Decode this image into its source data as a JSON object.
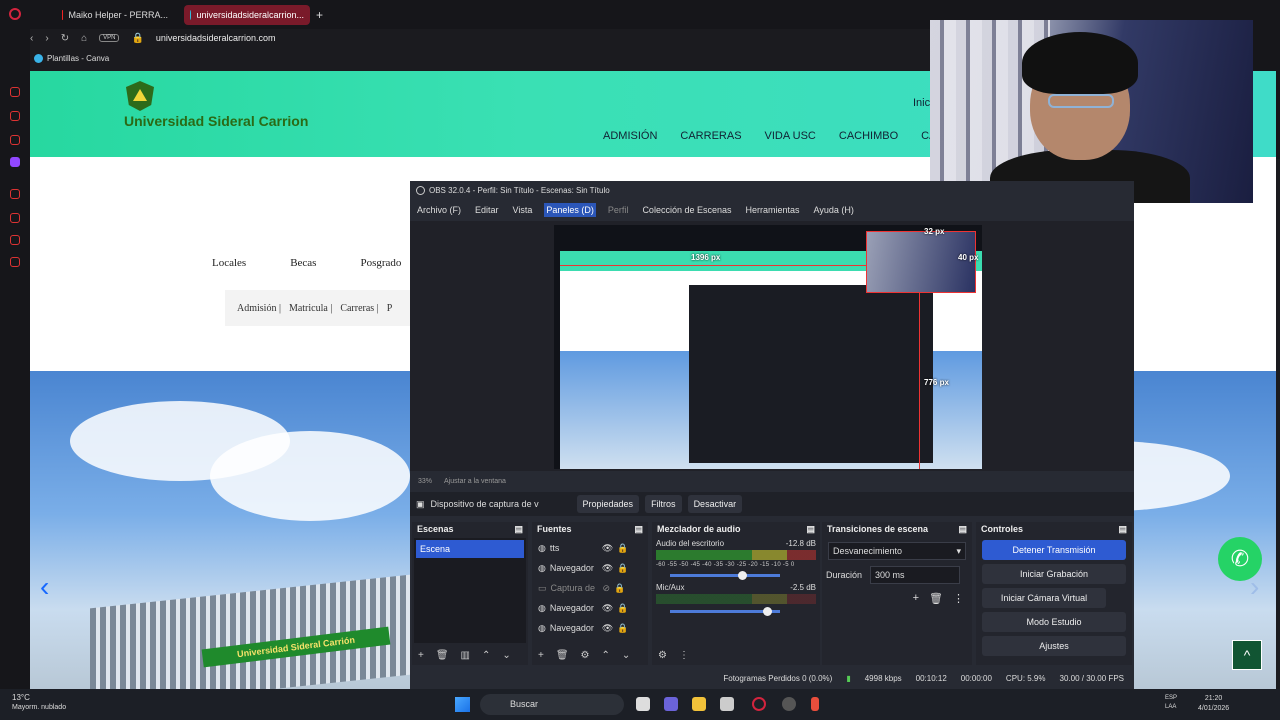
{
  "browser": {
    "tabs": [
      {
        "label": "Maiko Helper - PERRA...",
        "active": false
      },
      {
        "label": "universidadsideralcarrion...",
        "active": true
      }
    ],
    "vpn_label": "VPN",
    "url": "universidadsideralcarrion.com",
    "bookmark": "Plantillas - Canva"
  },
  "site": {
    "title": "Universidad Sideral Carrion",
    "top_link": "Inic",
    "menu": [
      "ADMISIÓN",
      "CARRERAS",
      "VIDA USC",
      "CACHIMBO",
      "CAMP"
    ],
    "subnav": [
      "Locales",
      "Becas",
      "Posgrado"
    ],
    "subbar": [
      "Admisión |",
      "Matricula |",
      "Carreras |",
      "P"
    ],
    "banner": "Universidad Sideral Carrión",
    "arrow_left": "‹",
    "arrow_right": "›",
    "whatsapp_icon": "✆",
    "up_icon": "^"
  },
  "obs": {
    "window_title": "OBS 32.0.4 - Perfil: Sin Título - Escenas: Sin Título",
    "menu": [
      "Archivo (F)",
      "Editar",
      "Vista",
      "Paneles (D)",
      "Perfil",
      "Colección de Escenas",
      "Herramientas",
      "Ayuda (H)"
    ],
    "measures": {
      "w": "1396 px",
      "top": "32 px",
      "right": "40 px",
      "bottom": "776 px"
    },
    "preview_status": {
      "zoom": "33%",
      "fit": "Ajustar a la ventana"
    },
    "source_bar": {
      "source": "Dispositivo de captura de v",
      "props": "Propiedades",
      "filters": "Filtros",
      "deactivate": "Desactivar"
    },
    "scenes": {
      "title": "Escenas",
      "items": [
        "Escena"
      ]
    },
    "sources": {
      "title": "Fuentes",
      "items": [
        {
          "name": "tts",
          "dim": false
        },
        {
          "name": "Navegador",
          "dim": false
        },
        {
          "name": "Captura de",
          "dim": true
        },
        {
          "name": "Navegador",
          "dim": false
        },
        {
          "name": "Navegador",
          "dim": false
        }
      ]
    },
    "mixer": {
      "title": "Mezclador de audio",
      "channels": [
        {
          "name": "Audio del escritorio",
          "db": "-12.8 dB",
          "level": 0.62
        },
        {
          "name": "Mic/Aux",
          "db": "-2.5 dB",
          "level": 0.85
        }
      ],
      "scale": "-60 -55 -50 -45 -40 -35 -30 -25 -20 -15 -10 -5 0"
    },
    "transitions": {
      "title": "Transiciones de escena",
      "selected": "Desvanecimiento",
      "duration_label": "Duración",
      "duration": "300 ms"
    },
    "controls": {
      "title": "Controles",
      "buttons": [
        "Detener Transmisión",
        "Iniciar Grabación",
        "Iniciar Cámara Virtual",
        "Modo Estudio",
        "Ajustes"
      ]
    },
    "status": {
      "dropped": "Fotogramas Perdidos 0 (0.0%)",
      "bitrate": "4998 kbps",
      "live": "00:10:12",
      "rec": "00:00:00",
      "cpu": "CPU: 5.9%",
      "fps": "30.00 / 30.00 FPS"
    }
  },
  "taskbar": {
    "temp": "13°C",
    "weather": "Mayorm. nublado",
    "search": "Buscar",
    "lang1": "ESP",
    "lang2": "LAA",
    "time": "21:20",
    "date": "4/01/2026"
  }
}
